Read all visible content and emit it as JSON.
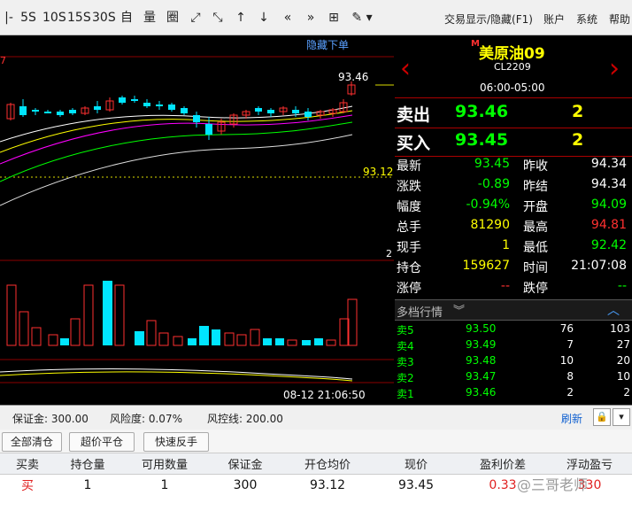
{
  "toolbar": {
    "periods": [
      "5S",
      "10S",
      "15S",
      "30S"
    ],
    "zi_label": "自",
    "liang_label": "量",
    "right_items": [
      "交易显示/隐藏(F1)",
      "账户",
      "系统",
      "帮助"
    ]
  },
  "chart": {
    "hide_order_label": "隐藏下单",
    "top_left_fragment": "7",
    "last_high_label": "93.46",
    "avg_price_label": "93.12",
    "side_fragment": "2",
    "timestamp": "08-12 21:06:50",
    "colors": {
      "up": "#ff3030",
      "down": "#00e5ff",
      "ma1": "#ffffff",
      "ma2": "#ffff00",
      "ma3": "#ff00ff",
      "ma4": "#00ff00",
      "ma5": "#ffffff"
    }
  },
  "quote": {
    "name": "美原油09",
    "badge": "M",
    "code": "CL2209",
    "session": "06:00-05:00",
    "sell_label": "卖出",
    "sell_price": "93.46",
    "sell_qty": "2",
    "buy_label": "买入",
    "buy_price": "93.45",
    "buy_qty": "2",
    "rows": [
      {
        "l1": "最新",
        "v1": "93.45",
        "l2": "昨收",
        "v2": "94.34"
      },
      {
        "l1": "涨跌",
        "v1": "-0.89",
        "l2": "昨结",
        "v2": "94.34"
      },
      {
        "l1": "幅度",
        "v1": "-0.94%",
        "l2": "开盘",
        "v2": "94.09"
      },
      {
        "l1": "总手",
        "v1": "81290",
        "l2": "最高",
        "v2": "94.81"
      },
      {
        "l1": "现手",
        "v1": "1",
        "l2": "最低",
        "v2": "92.42"
      },
      {
        "l1": "持仓",
        "v1": "159627",
        "l2": "时间",
        "v2": "21:07:08"
      },
      {
        "l1": "涨停",
        "v1": "--",
        "l2": "跌停",
        "v2": "--"
      }
    ],
    "depth_title": "多档行情",
    "depth": [
      {
        "label": "卖5",
        "price": "93.50",
        "qty": "76",
        "total": "103"
      },
      {
        "label": "卖4",
        "price": "93.49",
        "qty": "7",
        "total": "27"
      },
      {
        "label": "卖3",
        "price": "93.48",
        "qty": "10",
        "total": "20"
      },
      {
        "label": "卖2",
        "price": "93.47",
        "qty": "8",
        "total": "10"
      },
      {
        "label": "卖1",
        "price": "93.46",
        "qty": "2",
        "total": "2"
      }
    ]
  },
  "status": {
    "margin": "保证金: 300.00",
    "risk": "风险度: 0.07%",
    "risk_line": "风控线: 200.00",
    "refresh": "刷新"
  },
  "actions": [
    "全部清仓",
    "超价平仓",
    "快速反手"
  ],
  "positions": {
    "headers": [
      "买卖",
      "持仓量",
      "可用数量",
      "保证金",
      "开仓均价",
      "现价",
      "盈利价差",
      "浮动盈亏"
    ],
    "rows": [
      {
        "side": "买",
        "qty": "1",
        "avail": "1",
        "margin": "300",
        "open": "93.12",
        "price": "93.45",
        "diff": "0.33",
        "pnl": "330"
      }
    ]
  },
  "watermark": "@三哥老师"
}
